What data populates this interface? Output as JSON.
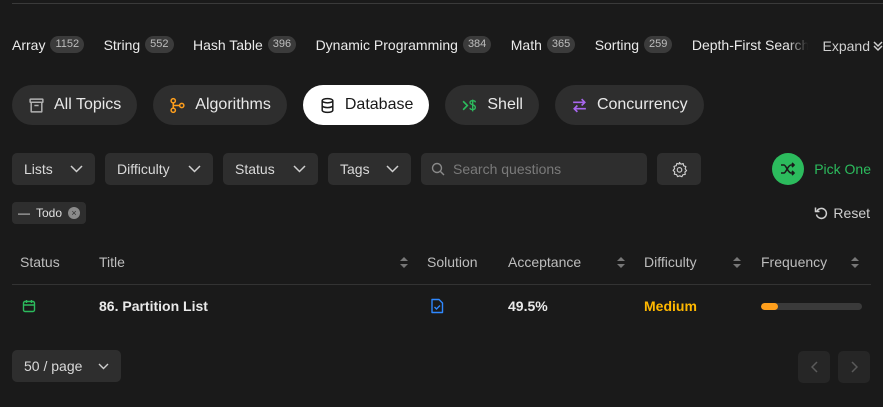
{
  "tags": [
    {
      "name": "Array",
      "count": "1152"
    },
    {
      "name": "String",
      "count": "552"
    },
    {
      "name": "Hash Table",
      "count": "396"
    },
    {
      "name": "Dynamic Programming",
      "count": "384"
    },
    {
      "name": "Math",
      "count": "365"
    },
    {
      "name": "Sorting",
      "count": "259"
    },
    {
      "name": "Depth-First Search",
      "count": ""
    }
  ],
  "expand_label": "Expand",
  "categories": [
    {
      "label": "All Topics",
      "icon": "list-box-icon",
      "color": "#b3b3b3"
    },
    {
      "label": "Algorithms",
      "icon": "algorithms-icon",
      "color": "#ff9f1c"
    },
    {
      "label": "Database",
      "icon": "database-icon",
      "color": "#1a1a1a",
      "active": true
    },
    {
      "label": "Shell",
      "icon": "shell-icon",
      "color": "#2cbb5d"
    },
    {
      "label": "Concurrency",
      "icon": "concurrency-icon",
      "color": "#a866ee"
    }
  ],
  "filters": {
    "lists": "Lists",
    "difficulty": "Difficulty",
    "status": "Status",
    "tags": "Tags",
    "search_placeholder": "Search questions",
    "pick_one": "Pick One"
  },
  "active_filter_chip": "Todo",
  "reset_label": "Reset",
  "table": {
    "headers": {
      "status": "Status",
      "title": "Title",
      "solution": "Solution",
      "acceptance": "Acceptance",
      "difficulty": "Difficulty",
      "frequency": "Frequency"
    },
    "rows": [
      {
        "title": "86. Partition List",
        "acceptance": "49.5%",
        "difficulty": "Medium",
        "frequency": 0.17
      }
    ]
  },
  "pagination": {
    "per_page": "50 / page"
  },
  "colors": {
    "accent_green": "#2cbb5d",
    "medium": "#ffb800",
    "solution_blue": "#2f88ff"
  }
}
